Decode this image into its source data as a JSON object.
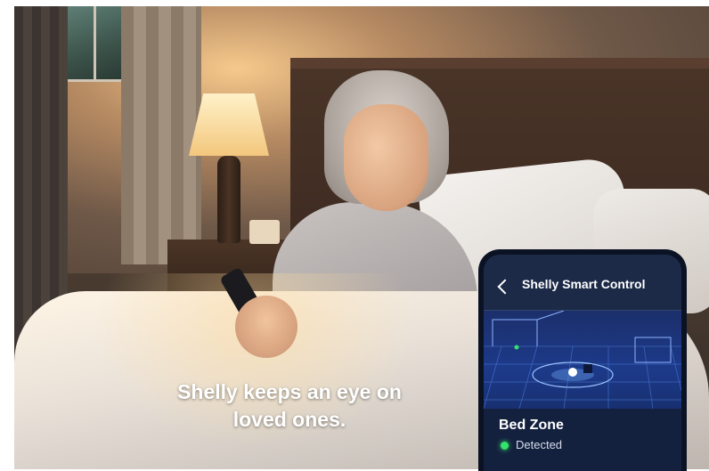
{
  "caption": {
    "line1": "Shelly keeps an eye on",
    "line2": "loved ones."
  },
  "phone": {
    "back_icon": "chevron-left-icon",
    "title": "Shelly Smart Control",
    "zone": {
      "name": "Bed Zone",
      "status": "Detected",
      "status_color": "#34e36b"
    }
  }
}
